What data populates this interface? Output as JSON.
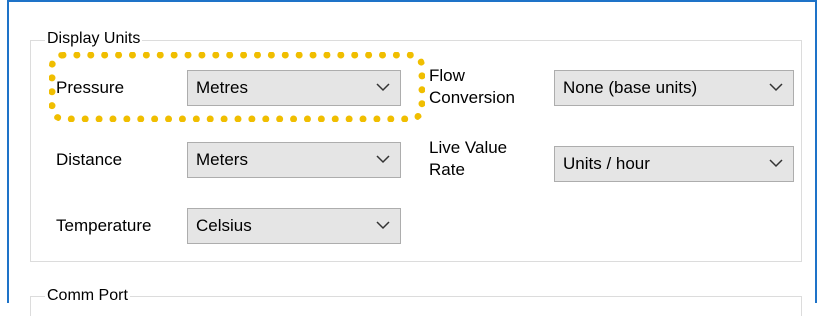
{
  "display_units": {
    "legend": "Display Units",
    "pressure": {
      "label": "Pressure",
      "value": "Metres"
    },
    "distance": {
      "label": "Distance",
      "value": "Meters"
    },
    "temperature": {
      "label": "Temperature",
      "value": "Celsius"
    },
    "flow_conversion": {
      "label_line1": "Flow",
      "label_line2": "Conversion",
      "value": "None (base units)"
    },
    "live_value_rate": {
      "label_line1": "Live Value",
      "label_line2": "Rate",
      "value": "Units / hour"
    }
  },
  "comm_port": {
    "legend": "Comm Port"
  },
  "colors": {
    "window_border": "#1e73c8",
    "highlight": "#f0be00",
    "combo_bg": "#e5e5e5"
  },
  "icons": {
    "dropdown": "chevron-down-icon"
  }
}
